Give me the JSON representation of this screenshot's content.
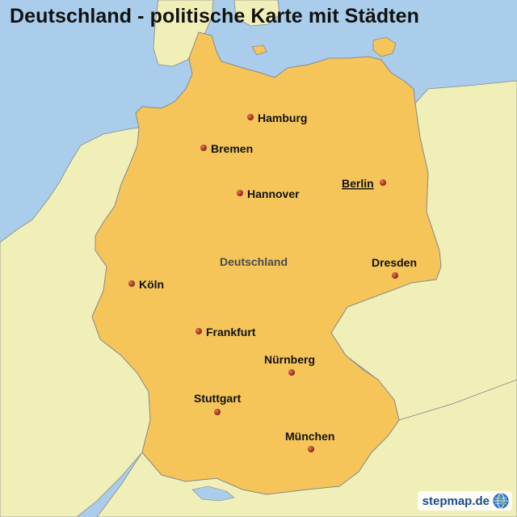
{
  "map": {
    "title": "Deutschland - politische Karte mit Städten",
    "country_label": "Deutschland",
    "brand": "stepmap.de",
    "brand_icon": "globe-icon",
    "colors": {
      "sea": "#a9cdea",
      "neighbour_land": "#f1efb8",
      "germany": "#f5c55a",
      "border": "#8a8a8a",
      "city_dot": "#a8331a"
    },
    "cities": [
      {
        "name": "Hamburg",
        "capital": false
      },
      {
        "name": "Bremen",
        "capital": false
      },
      {
        "name": "Hannover",
        "capital": false
      },
      {
        "name": "Berlin",
        "capital": true
      },
      {
        "name": "Dresden",
        "capital": false
      },
      {
        "name": "Köln",
        "capital": false
      },
      {
        "name": "Frankfurt",
        "capital": false
      },
      {
        "name": "Nürnberg",
        "capital": false
      },
      {
        "name": "Stuttgart",
        "capital": false
      },
      {
        "name": "München",
        "capital": false
      }
    ]
  }
}
